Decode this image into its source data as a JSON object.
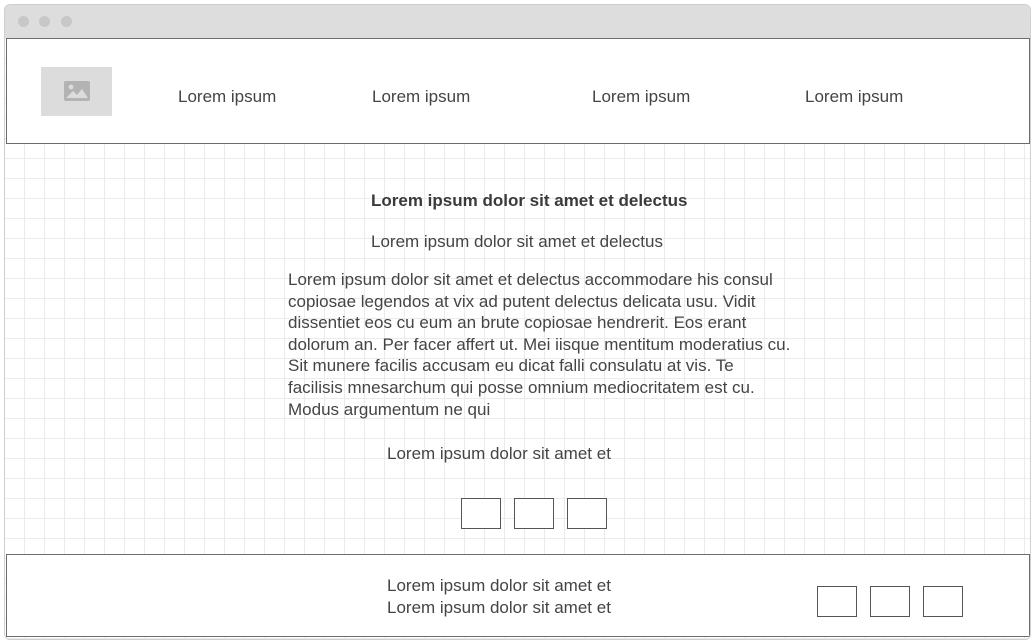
{
  "window": {
    "controls": [
      "close",
      "minimize",
      "maximize"
    ]
  },
  "header": {
    "logo_icon": "image-placeholder-icon",
    "nav": [
      {
        "label": "Lorem ipsum"
      },
      {
        "label": "Lorem ipsum"
      },
      {
        "label": "Lorem ipsum"
      },
      {
        "label": "Lorem ipsum"
      }
    ]
  },
  "main": {
    "heading": "Lorem ipsum dolor sit amet et delectus",
    "subheading": "Lorem ipsum dolor sit amet et delectus",
    "body": "Lorem ipsum dolor sit amet et delectus accommodare his consul copiosae legendos at vix ad putent delectus delicata usu. Vidit dissentiet eos cu eum an brute copiosae hendrerit. Eos erant dolorum an. Per facer affert ut. Mei iisque mentitum moderatius cu. Sit munere facilis accusam eu dicat falli consulatu at vis. Te facilisis mnesarchum qui posse omnium mediocritatem est cu. Modus argumentum ne qui",
    "caption": "Lorem ipsum dolor sit amet et"
  },
  "footer": {
    "lines": [
      "Lorem ipsum dolor sit amet et",
      "Lorem ipsum dolor sit amet et"
    ]
  },
  "colors": {
    "titlebar": "#dddddd",
    "grid_line": "#ebebeb",
    "border": "#6b6b6b",
    "placeholder": "#dcdcdc",
    "text": "#444444"
  }
}
